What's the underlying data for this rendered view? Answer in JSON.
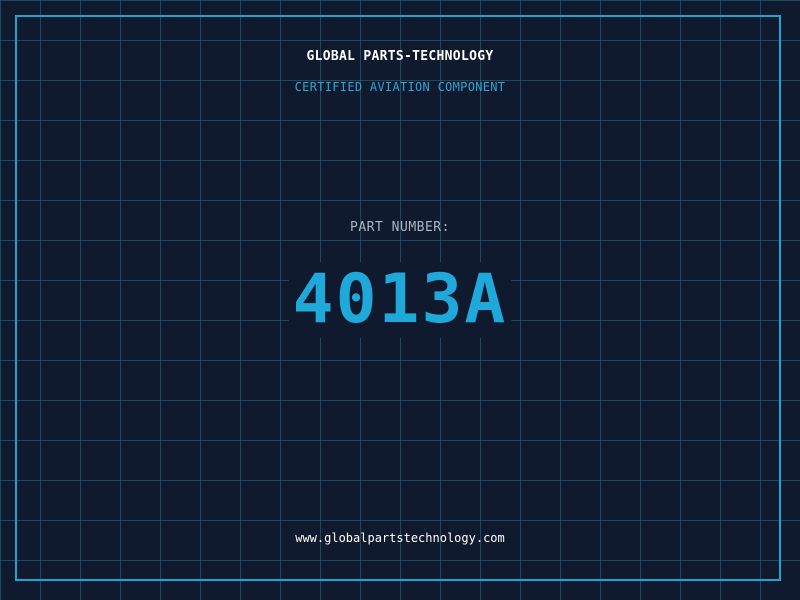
{
  "header": {
    "company": "GLOBAL PARTS-TECHNOLOGY",
    "tagline": "CERTIFIED AVIATION COMPONENT"
  },
  "part": {
    "label": "PART NUMBER:",
    "number": "4013A"
  },
  "footer": {
    "website": "www.globalpartstechnology.com"
  },
  "colors": {
    "background": "#101a2e",
    "accent": "#1fa9db",
    "grid": "#28829f",
    "label": "#aab6c4"
  }
}
